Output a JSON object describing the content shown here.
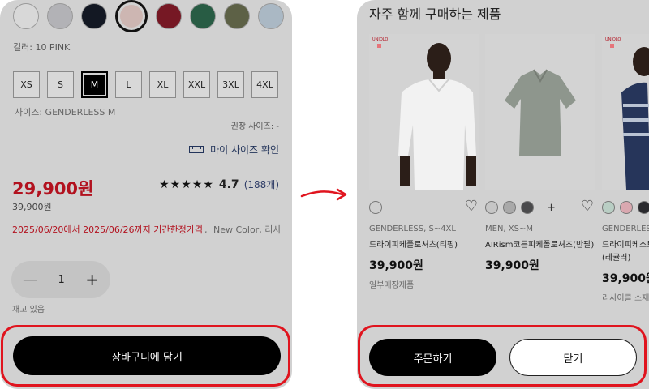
{
  "left": {
    "swatches": [
      {
        "name": "white",
        "color": "#d8d8d8"
      },
      {
        "name": "light-gray",
        "color": "#b2b2b6"
      },
      {
        "name": "navy",
        "color": "#131823"
      },
      {
        "name": "pink",
        "color": "#cdb6b2",
        "selected": true
      },
      {
        "name": "red",
        "color": "#761824"
      },
      {
        "name": "green",
        "color": "#285c44"
      },
      {
        "name": "olive",
        "color": "#5d6146"
      },
      {
        "name": "light-blue",
        "color": "#aab8c4"
      },
      {
        "name": "blue",
        "color": "#344b6e"
      }
    ],
    "color_label": "컬러: 10 PINK",
    "sizes": [
      "XS",
      "S",
      "M",
      "L",
      "XL",
      "XXL",
      "3XL",
      "4XL"
    ],
    "selected_size": "M",
    "size_info": "사이즈: GENDERLESS M",
    "recommended_size": "권장 사이즈: -",
    "my_size_link": "마이 사이즈 확인",
    "price": "29,900원",
    "original_price": "39,900원",
    "rating_stars": "★★★★★",
    "rating_value": "4.7",
    "review_count": "(188개)",
    "promo_red": "2025/06/20에서 2025/06/26까지 기간한정가격",
    "promo_sep": ",",
    "promo_new": "New Color,",
    "promo_more": "리사",
    "quantity": "1",
    "minus": "—",
    "plus": "+",
    "stock_label": "재고 있음",
    "add_to_cart": "장바구니에 담기"
  },
  "right": {
    "section_title": "자주 함께 구매하는 제품",
    "brand_tag": "UNIQLO",
    "products": [
      {
        "meta": "GENDERLESS, S~4XL",
        "name": "드라이피케폴로셔츠(티핑)",
        "price": "39,900원",
        "extra": "일부매장제품",
        "colors": [
          "#cfcfcf"
        ],
        "plus": "",
        "heart": "♡"
      },
      {
        "meta": "MEN, XS~M",
        "name": "AIRism코튼피케폴로셔츠(반팔)",
        "price": "39,900원",
        "extra": "",
        "colors": [
          "#c6c6c6",
          "#a9a9a9",
          "#4a4a4c"
        ],
        "plus": "+",
        "heart": "♡"
      },
      {
        "meta": "GENDERLESS",
        "name": "드라이피케스트라이프폴로셔츠(레귤러)",
        "price": "39,900원",
        "extra": "리사이클 소재",
        "colors": [
          "#b9cec4",
          "#d9a8b0",
          "#2a2a2e"
        ],
        "plus": "",
        "heart": ""
      }
    ],
    "order_button": "주문하기",
    "close_button": "닫기"
  },
  "colors": {
    "sale_red": "#b2121f",
    "highlight_red": "#e0141e",
    "link_navy": "#2d3b66"
  }
}
